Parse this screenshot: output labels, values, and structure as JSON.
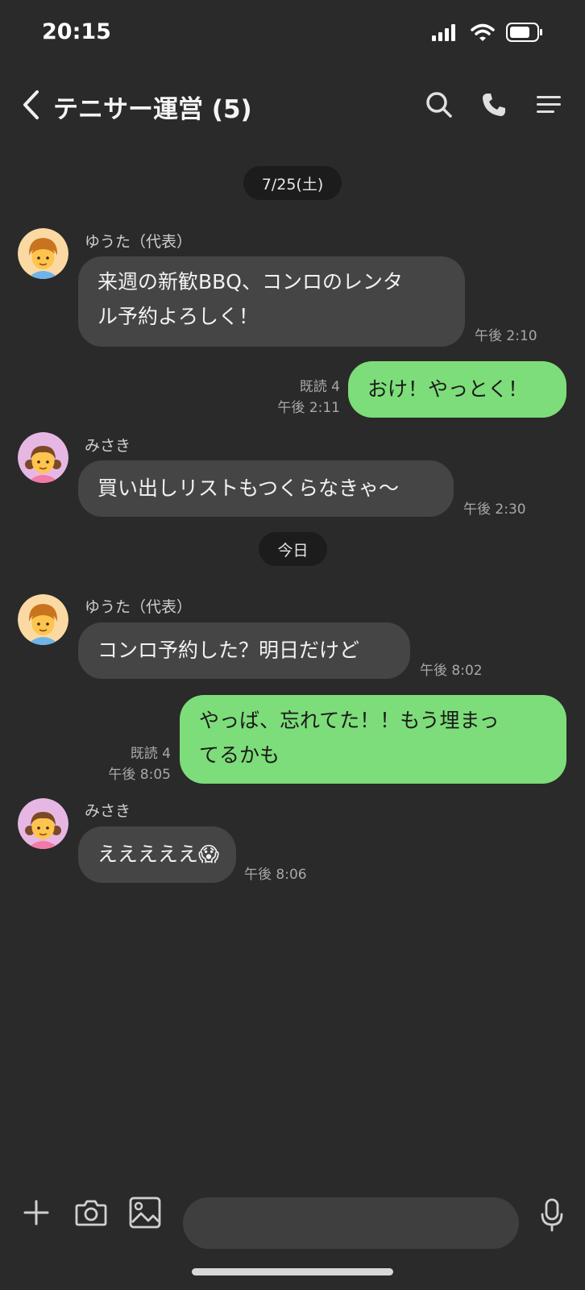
{
  "status": {
    "time": "20:15"
  },
  "header": {
    "title": "テニサー運営 (5)"
  },
  "chat": {
    "date1": "7/25(土)",
    "date2": "今日",
    "messages": [
      {
        "sender": "ゆうた（代表）",
        "lines": [
          "来週の新歓BBQ、コンロのレンタ",
          "ル予約よろしく！"
        ],
        "time": "午後 2:10"
      },
      {
        "lines": [
          "おけ！やっとく！"
        ],
        "read": "既読 4",
        "time": "午後 2:11"
      },
      {
        "sender": "みさき",
        "lines": [
          "買い出しリストもつくらなきゃ〜"
        ],
        "time": "午後 2:30"
      },
      {
        "sender": "ゆうた（代表）",
        "lines": [
          "コンロ予約した？明日だけど"
        ],
        "time": "午後 8:02"
      },
      {
        "lines": [
          "やっば、忘れてた！！もう埋まっ",
          "てるかも"
        ],
        "read": "既読 4",
        "time": "午後 8:05"
      },
      {
        "sender": "みさき",
        "lines": [
          "えええええ😱"
        ],
        "time": "午後 8:06"
      }
    ]
  },
  "input": {
    "placeholder": ""
  },
  "colors": {
    "background": "#2a2a2a",
    "incoming_bubble": "#454545",
    "outgoing_bubble": "#7ddd7a",
    "date_chip": "#1c1c1c"
  },
  "icons": [
    "back-icon",
    "search-icon",
    "phone-icon",
    "menu-icon",
    "plus-icon",
    "camera-icon",
    "image-icon",
    "mic-icon"
  ]
}
